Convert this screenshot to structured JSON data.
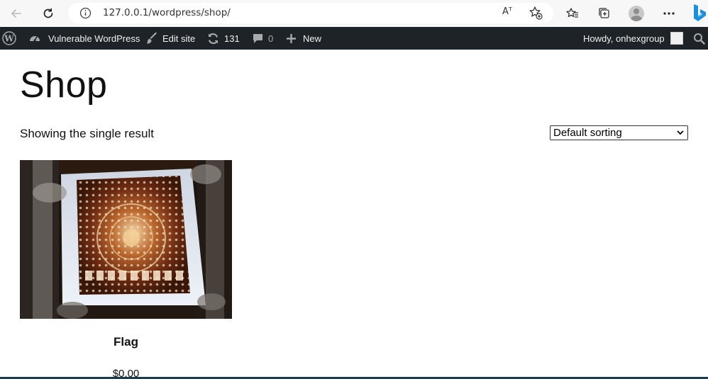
{
  "browser": {
    "url": "127.0.0.1/wordpress/shop/",
    "read_aloud_label": "Aᵀ",
    "colors": {
      "chrome_bg": "#f7f7f7",
      "address_bg": "#ffffff"
    }
  },
  "admin_bar": {
    "site_name": "Vulnerable WordPress",
    "edit_site": "Edit site",
    "updates_count": "131",
    "comments_count": "0",
    "new_label": "New",
    "howdy": "Howdy, onhexgroup",
    "colors": {
      "bg": "#1d2327",
      "text": "#f0f0f1",
      "muted": "#a7aaad"
    }
  },
  "page": {
    "title": "Shop",
    "result_count": "Showing the single result",
    "sorting": {
      "selected": "Default sorting"
    }
  },
  "products": [
    {
      "title": "Flag",
      "price": "$0.00"
    }
  ]
}
